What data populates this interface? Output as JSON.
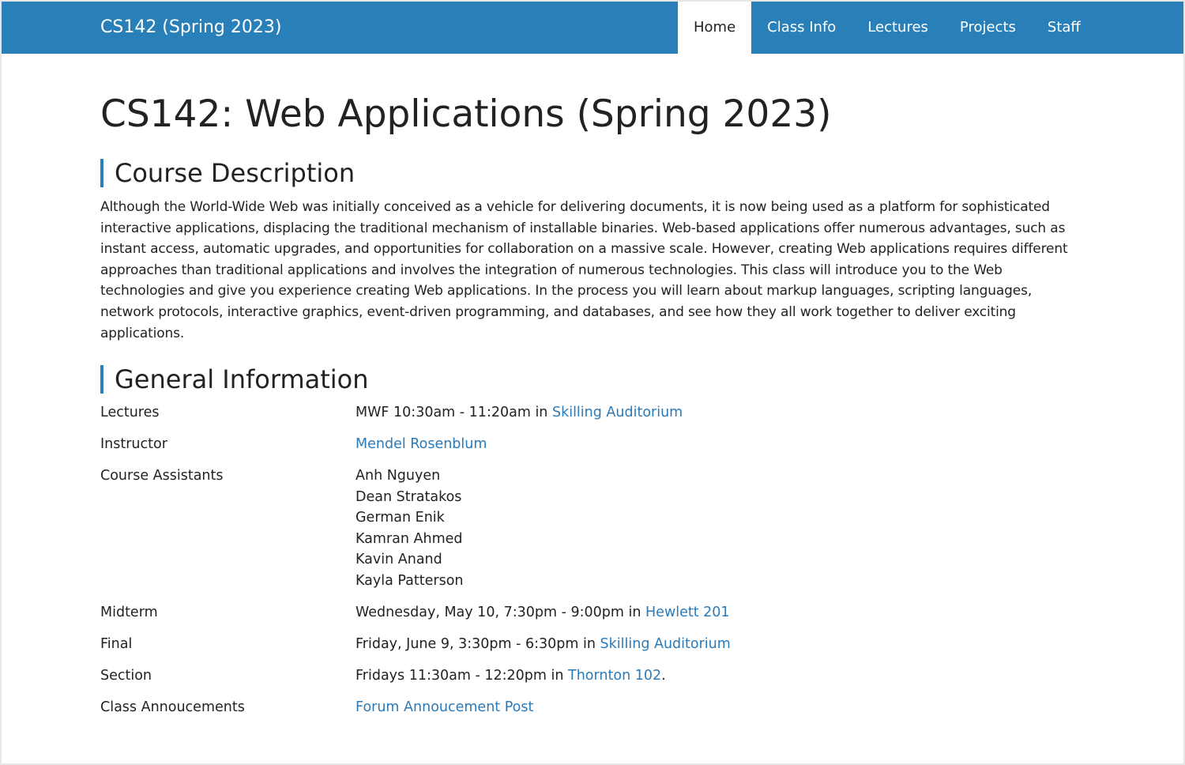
{
  "navbar": {
    "brand": "CS142 (Spring 2023)",
    "items": [
      {
        "label": "Home",
        "active": true
      },
      {
        "label": "Class Info",
        "active": false
      },
      {
        "label": "Lectures",
        "active": false
      },
      {
        "label": "Projects",
        "active": false
      },
      {
        "label": "Staff",
        "active": false
      }
    ]
  },
  "page": {
    "title": "CS142: Web Applications (Spring 2023)",
    "course_description": {
      "heading": "Course Description",
      "text": "Although the World-Wide Web was initially conceived as a vehicle for delivering documents, it is now being used as a platform for sophisticated interactive applications, displacing the traditional mechanism of installable binaries. Web-based applications offer numerous advantages, such as instant access, automatic upgrades, and opportunities for collaboration on a massive scale. However, creating Web applications requires different approaches than traditional applications and involves the integration of numerous technologies. This class will introduce you to the Web technologies and give you experience creating Web applications. In the process you will learn about markup languages, scripting languages, network protocols, interactive graphics, event-driven programming, and databases, and see how they all work together to deliver exciting applications."
    },
    "general_info": {
      "heading": "General Information",
      "lectures": {
        "label": "Lectures",
        "text": "MWF 10:30am - 11:20am in ",
        "link": "Skilling Auditorium"
      },
      "instructor": {
        "label": "Instructor",
        "link": "Mendel Rosenblum"
      },
      "assistants": {
        "label": "Course Assistants",
        "names": [
          "Anh Nguyen",
          "Dean Stratakos",
          "German Enik",
          "Kamran Ahmed",
          "Kavin Anand",
          "Kayla Patterson"
        ]
      },
      "midterm": {
        "label": "Midterm",
        "text": "Wednesday, May 10, 7:30pm - 9:00pm in ",
        "link": "Hewlett 201"
      },
      "final": {
        "label": "Final",
        "text": "Friday, June 9, 3:30pm - 6:30pm in ",
        "link": "Skilling Auditorium"
      },
      "section": {
        "label": "Section",
        "text": "Fridays 11:30am - 12:20pm in ",
        "link": "Thornton 102",
        "suffix": "."
      },
      "announcements": {
        "label": "Class Annoucements",
        "link": "Forum Annoucement Post"
      }
    }
  },
  "colors": {
    "navbar_bg": "#2980b9",
    "link": "#2a7ab8",
    "text": "#222222"
  }
}
